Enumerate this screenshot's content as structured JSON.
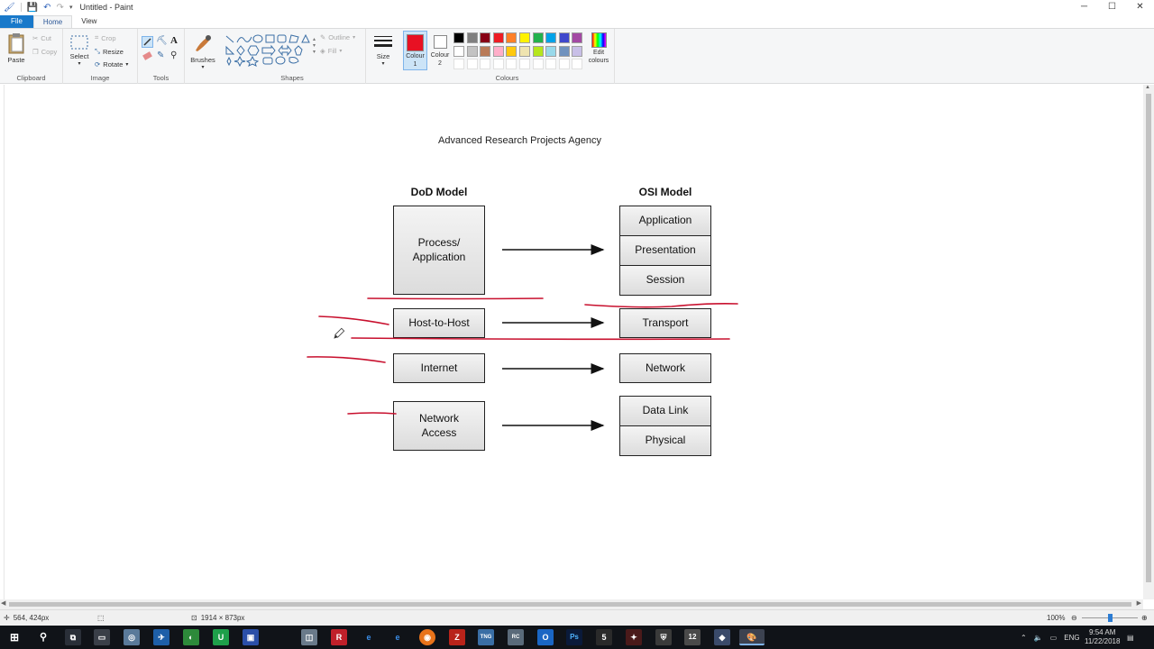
{
  "window": {
    "title": "Untitled - Paint",
    "controls": {
      "minimize": "─",
      "maximize": "☐",
      "close": "✕"
    }
  },
  "ribbon_tabs": [
    {
      "label": "File"
    },
    {
      "label": "Home"
    },
    {
      "label": "View"
    }
  ],
  "clipboard": {
    "paste": "Paste",
    "cut": "Cut",
    "copy": "Copy",
    "group": "Clipboard"
  },
  "image": {
    "select": "Select",
    "crop": "Crop",
    "resize": "Resize",
    "rotate": "Rotate",
    "group": "Image"
  },
  "tools": {
    "group": "Tools"
  },
  "brushes": {
    "label": "Brushes"
  },
  "shapes": {
    "outline": "Outline",
    "fill": "Fill",
    "group": "Shapes"
  },
  "size": {
    "label": "Size"
  },
  "colours": {
    "colour1_label": "Colour\n1",
    "colour2_label": "Colour\n2",
    "colour1": "#e81123",
    "colour2": "#ffffff",
    "edit_label": "Edit\ncolours",
    "group": "Colours",
    "palette_row1": [
      "#000000",
      "#7f7f7f",
      "#880015",
      "#ed1c24",
      "#ff7f27",
      "#fff200",
      "#22b14c",
      "#00a2e8",
      "#3f48cc",
      "#a349a4"
    ],
    "palette_row2": [
      "#ffffff",
      "#c3c3c3",
      "#b97a57",
      "#ffaec9",
      "#ffc90e",
      "#efe4b0",
      "#b5e61d",
      "#99d9ea",
      "#7092be",
      "#c8bfe7"
    ]
  },
  "diagram": {
    "title": "Advanced Research Projects Agency",
    "dod_heading": "DoD Model",
    "osi_heading": "OSI Model",
    "dod_layers": [
      "Process/\nApplication",
      "Host-to-Host",
      "Internet",
      "Network\nAccess"
    ],
    "osi_layers": [
      "Application",
      "Presentation",
      "Session",
      "Transport",
      "Network",
      "Data Link",
      "Physical"
    ],
    "annotation_color": "#c8102e"
  },
  "status": {
    "cursor_position": "564, 424px",
    "canvas_size": "1914 × 873px",
    "zoom": "100%"
  },
  "taskbar": {
    "language": "ENG",
    "time": "9:54 AM",
    "date": "11/22/2018"
  }
}
